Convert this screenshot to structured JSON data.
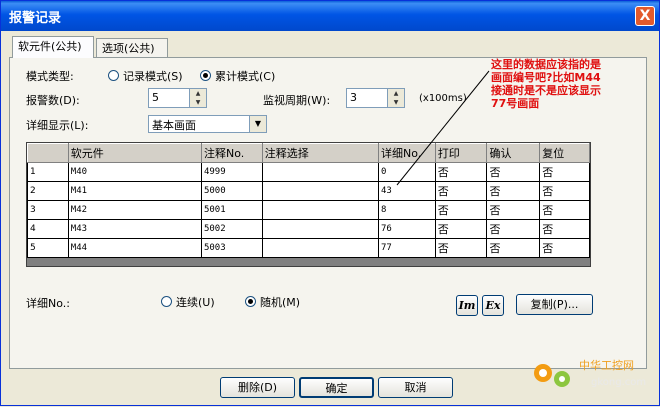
{
  "window": {
    "title": "报警记录",
    "close_label": "X"
  },
  "tabs": [
    {
      "label": "软元件(公共)"
    },
    {
      "label": "选项(公共)"
    }
  ],
  "mode": {
    "label": "模式类型:",
    "options": [
      {
        "label": "记录模式(S)",
        "selected": false
      },
      {
        "label": "累计模式(C)",
        "selected": true
      }
    ]
  },
  "alarm_count": {
    "label": "报警数(D):",
    "value": "5"
  },
  "monitor_period": {
    "label": "监视周期(W):",
    "value": "3",
    "unit": "(x100ms)"
  },
  "detail_display": {
    "label": "详细显示(L):",
    "value": "基本画面"
  },
  "annotation": {
    "lines": [
      "这里的数据应该指的是",
      "画面编号吧?比如M44",
      "接通时是不是应该显示",
      "77号画面"
    ],
    "color": "#e01010"
  },
  "table": {
    "columns": [
      "",
      "软元件",
      "注释No.",
      "注释选择",
      "详细No.",
      "打印",
      "确认",
      "复位"
    ],
    "rows": [
      {
        "n": "1",
        "device": "M40",
        "comment_no": "4999",
        "comment_sel": "",
        "detail_no": "0",
        "print": "否",
        "confirm": "否",
        "reset": "否"
      },
      {
        "n": "2",
        "device": "M41",
        "comment_no": "5000",
        "comment_sel": "",
        "detail_no": "43",
        "print": "否",
        "confirm": "否",
        "reset": "否"
      },
      {
        "n": "3",
        "device": "M42",
        "comment_no": "5001",
        "comment_sel": "",
        "detail_no": "8",
        "print": "否",
        "confirm": "否",
        "reset": "否"
      },
      {
        "n": "4",
        "device": "M43",
        "comment_no": "5002",
        "comment_sel": "",
        "detail_no": "76",
        "print": "否",
        "confirm": "否",
        "reset": "否"
      },
      {
        "n": "5",
        "device": "M44",
        "comment_no": "5003",
        "comment_sel": "",
        "detail_no": "77",
        "print": "否",
        "confirm": "否",
        "reset": "否"
      }
    ]
  },
  "detail_no": {
    "label": "详细No.:",
    "options": [
      {
        "label": "连续(U)",
        "selected": false
      },
      {
        "label": "随机(M)",
        "selected": true
      }
    ]
  },
  "tools": {
    "im_label": "Im",
    "ex_label": "Ex",
    "copy_label": "复制(P)..."
  },
  "footer": {
    "delete_label": "删除(D)",
    "ok_label": "确定",
    "cancel_label": "取消"
  },
  "watermark": {
    "text": "中华工控网",
    "url": "gkong.com"
  }
}
